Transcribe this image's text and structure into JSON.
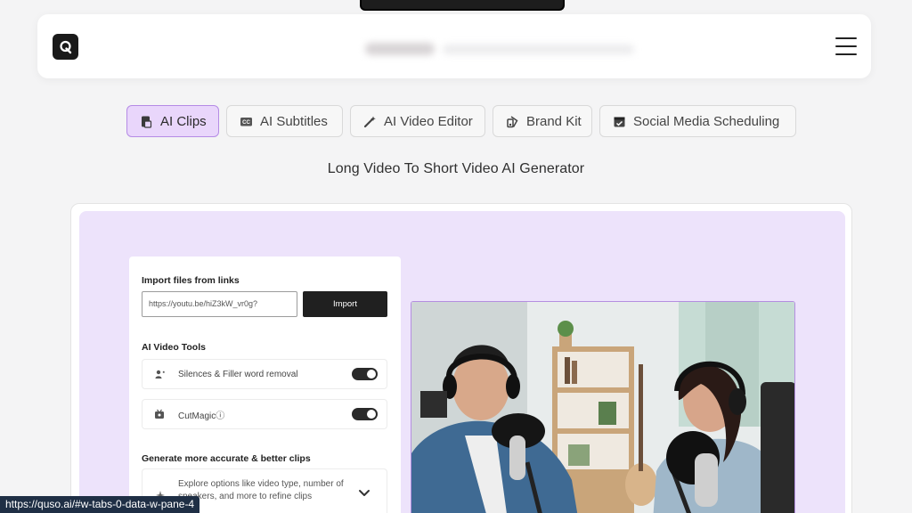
{
  "header": {
    "logo_icon": "quso-logo-icon",
    "menu_icon": "hamburger-menu-icon"
  },
  "tabs": [
    {
      "label": "AI Clips",
      "icon": "clips-icon",
      "active": true
    },
    {
      "label": "AI Subtitles",
      "icon": "cc-icon",
      "active": false
    },
    {
      "label": "AI Video Editor",
      "icon": "magic-wand-icon",
      "active": false
    },
    {
      "label": "Brand Kit",
      "icon": "brand-kit-icon",
      "active": false
    },
    {
      "label": "Social Media Scheduling",
      "icon": "calendar-icon",
      "active": false
    }
  ],
  "subtitle": "Long Video To Short Video AI Generator",
  "panel": {
    "import_title": "Import files from links",
    "link_value": "https://youtu.be/hiZ3kW_vr0g?",
    "import_button": "Import",
    "tools_title": "AI Video Tools",
    "tools": [
      {
        "label": "Silences & Filler word removal",
        "icon": "filler-removal-icon",
        "enabled": true
      },
      {
        "label": "CutMagicⓘ",
        "icon": "cutmagic-icon",
        "enabled": true
      }
    ],
    "clips_title": "Generate more accurate & better clips",
    "explore_text": "Explore options like video type, number of speakers, and more to refine clips"
  },
  "colors": {
    "active_tab_bg": "#e9d6fb",
    "active_tab_border": "#b58be5",
    "preview_bg": "#ede3fb",
    "button_dark": "#202020"
  },
  "status_url": "https://quso.ai/#w-tabs-0-data-w-pane-4"
}
